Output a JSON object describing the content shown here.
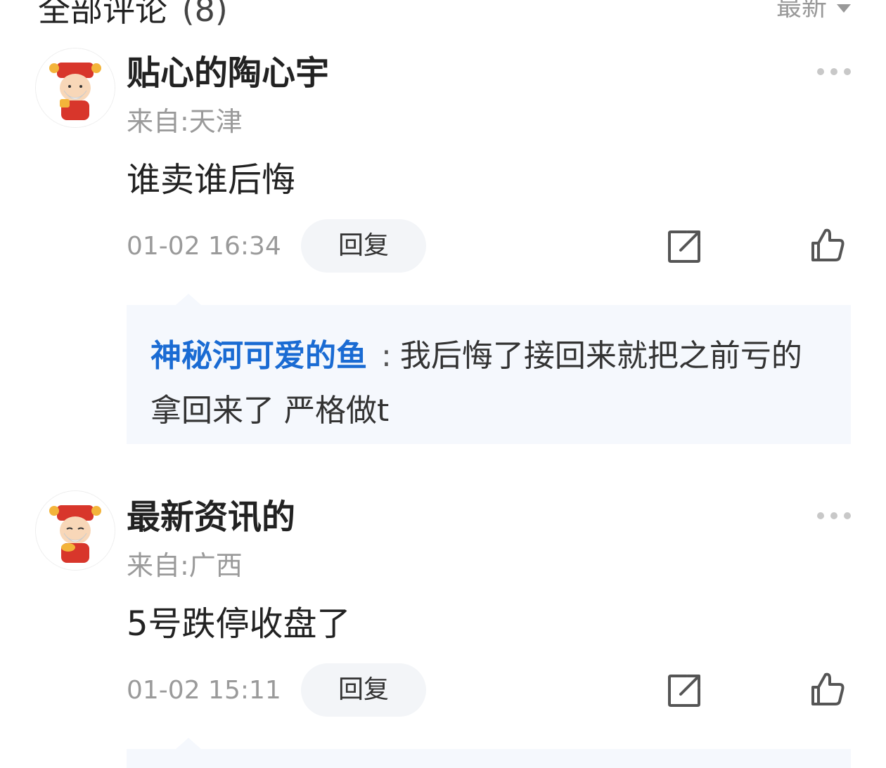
{
  "header": {
    "title": "全部评论",
    "count": "(8)",
    "sort_label": "最新"
  },
  "comments": [
    {
      "username": "贴心的陶心宇",
      "location": "来自:天津",
      "content": "谁卖谁后悔",
      "time": "01-02 16:34",
      "reply_label": "回复",
      "replies": [
        {
          "username": "神秘河可爱的鱼",
          "separator": ":",
          "text": "我后悔了接回来就把之前亏的拿回来了 严格做t"
        }
      ]
    },
    {
      "username": "最新资讯的",
      "location": "来自:广西",
      "content": "5号跌停收盘了",
      "time": "01-02 15:11",
      "reply_label": "回复",
      "replies": []
    }
  ],
  "colors": {
    "accent_link": "#1a6bd3",
    "muted_text": "#9a9a9a",
    "reply_bg": "#f5f8fd"
  },
  "icons": [
    "more-dots-icon",
    "share-icon",
    "thumbs-up-icon",
    "sort-caret-icon"
  ]
}
